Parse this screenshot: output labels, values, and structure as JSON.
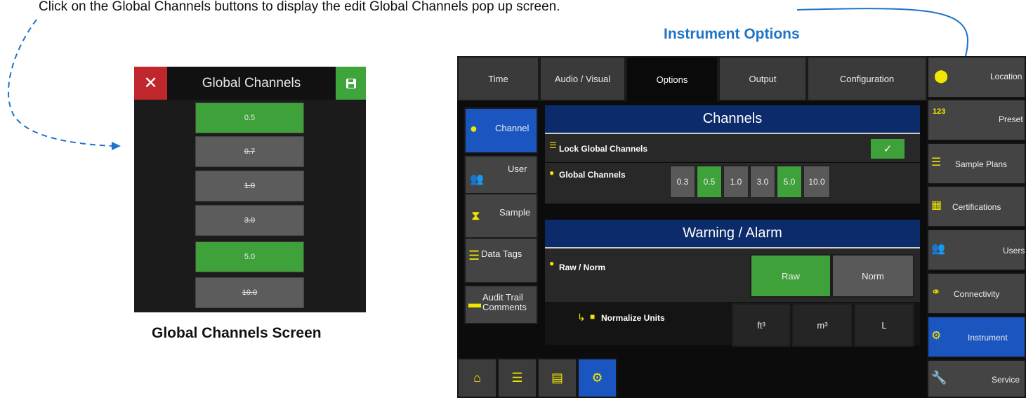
{
  "instruction": "Click on the Global Channels buttons to display the edit Global Channels pop up screen.",
  "captions": {
    "top": "Instrument Options",
    "bottom": "Global Channels Screen"
  },
  "popup": {
    "title": "Global Channels",
    "channels": [
      {
        "label": "0.5",
        "selected": true
      },
      {
        "label": "0.7",
        "selected": false
      },
      {
        "label": "1.0",
        "selected": false
      },
      {
        "label": "3.0",
        "selected": false
      },
      {
        "label": "5.0",
        "selected": true
      },
      {
        "label": "10.0",
        "selected": false
      }
    ]
  },
  "instrument": {
    "tabs": [
      "Time",
      "Audio / Visual",
      "Options",
      "Output",
      "Configuration"
    ],
    "active_tab": "Options",
    "side": [
      "Channel",
      "User",
      "Sample",
      "Data Tags",
      "Audit Trail",
      "Comments"
    ],
    "channels_section": {
      "title": "Channels",
      "lock_label": "Lock Global Channels",
      "global_label": "Global Channels",
      "values": [
        {
          "label": "0.3",
          "selected": false
        },
        {
          "label": "0.5",
          "selected": true
        },
        {
          "label": "1.0",
          "selected": false
        },
        {
          "label": "3.0",
          "selected": false
        },
        {
          "label": "5.0",
          "selected": true
        },
        {
          "label": "10.0",
          "selected": false
        }
      ]
    },
    "warning_section": {
      "title": "Warning / Alarm",
      "rawnorm_label": "Raw / Norm",
      "raw": "Raw",
      "norm": "Norm",
      "normalize_label": "Normalize Units",
      "units": [
        "ft³",
        "m³",
        "L"
      ]
    },
    "right_nav": [
      "Location",
      "123",
      "Preset",
      "Sample Plans",
      "Certifications",
      "Users",
      "Connectivity",
      "Instrument",
      "Service"
    ]
  },
  "colors": {
    "green": "#3fa13a",
    "blue": "#1a55c0",
    "red": "#c0272d",
    "accent": "#1f73c8"
  }
}
